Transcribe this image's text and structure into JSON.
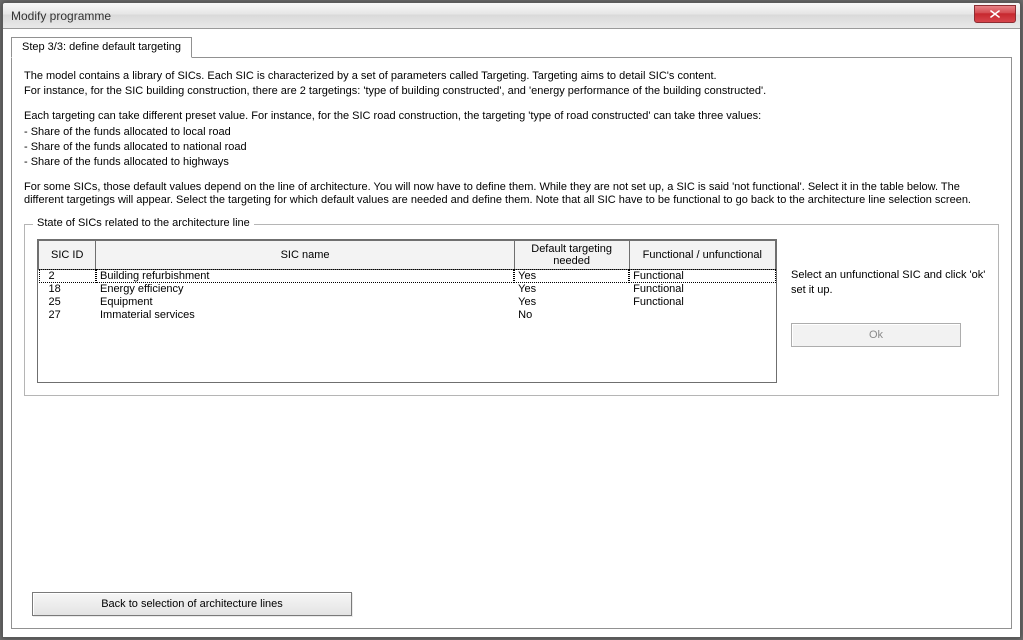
{
  "window": {
    "title": "Modify programme"
  },
  "tab": {
    "label": "Step 3/3: define default targeting"
  },
  "intro": {
    "p1": "The model contains a library of SICs. Each SIC is characterized by a set of parameters called Targeting. Targeting aims to detail SIC's content.",
    "p2": "For instance, for the SIC building construction, there are 2 targetings: 'type of building constructed', and 'energy performance of the building constructed'.",
    "p3": "Each targeting can take different preset value. For instance, for the SIC road construction, the targeting 'type of road constructed' can take three values:",
    "b1": "- Share of the funds allocated to local road",
    "b2": "- Share of the funds allocated to national road",
    "b3": "- Share of the funds allocated to highways",
    "p4": "For some SICs, those default values depend on the line of architecture. You will now have to define them. While they are not set up, a SIC is said 'not functional'. Select it in the table below. The different targetings will appear. Select the targeting for which default values are needed and define them. Note that all SIC have to be functional to go back to the architecture line selection screen."
  },
  "group": {
    "legend": "State of SICs related to the architecture line",
    "columns": {
      "id": "SIC ID",
      "name": "SIC name",
      "def": "Default targeting needed",
      "fun": "Functional / unfunctional"
    },
    "rows": [
      {
        "id": "2",
        "name": "Building refurbishment",
        "def": "Yes",
        "fun": "Functional"
      },
      {
        "id": "18",
        "name": "Energy efficiency",
        "def": "Yes",
        "fun": "Functional"
      },
      {
        "id": "25",
        "name": "Equipment",
        "def": "Yes",
        "fun": "Functional"
      },
      {
        "id": "27",
        "name": "Immaterial services",
        "def": "No",
        "fun": ""
      }
    ],
    "side": {
      "l1": "Select an unfunctional SIC and click 'ok'",
      "l2": "set it up.",
      "ok": "Ok"
    }
  },
  "back": "Back to selection of architecture lines"
}
